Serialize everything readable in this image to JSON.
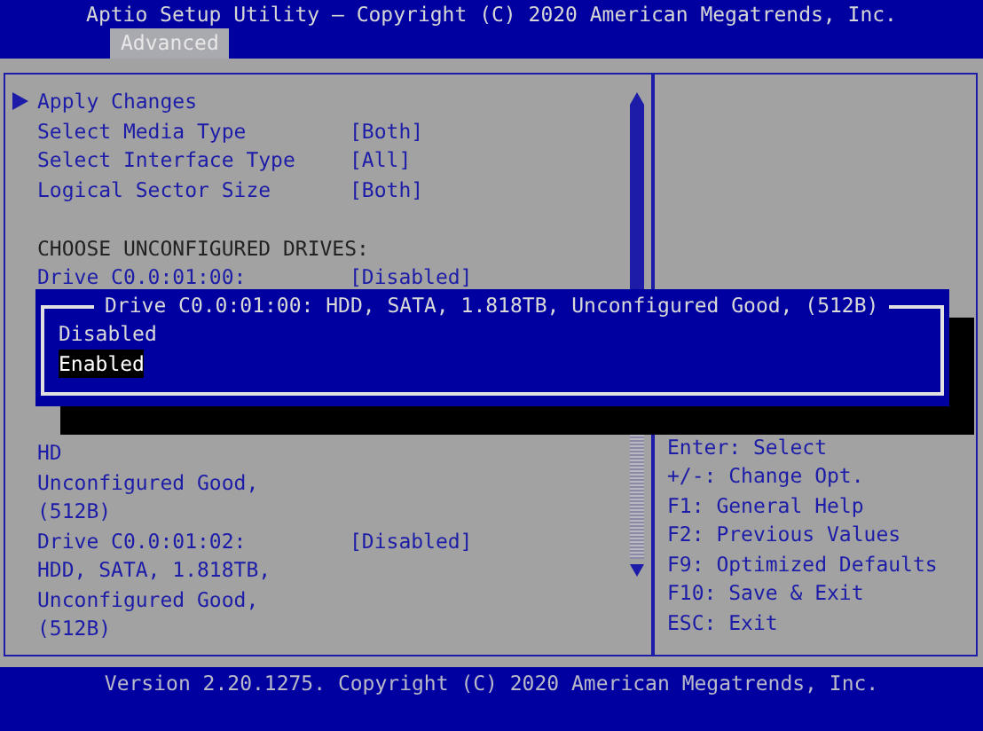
{
  "header": {
    "title": "Aptio Setup Utility – Copyright (C) 2020 American Megatrends, Inc."
  },
  "tabs": [
    {
      "label": "Advanced",
      "selected": true
    }
  ],
  "settings_above": [
    {
      "kind": "submenu",
      "label": "Apply Changes"
    },
    {
      "kind": "option",
      "label": "Select Media Type",
      "value": "[Both]"
    },
    {
      "kind": "option",
      "label": "Select Interface Type",
      "value": "[All]"
    },
    {
      "kind": "option",
      "label": "Logical Sector Size",
      "value": "[Both]"
    },
    {
      "kind": "heading",
      "label": "CHOOSE UNCONFIGURED DRIVES:"
    },
    {
      "kind": "option",
      "label": "Drive C0.0:01:00:",
      "value": "[Disabled]"
    }
  ],
  "settings_below": [
    {
      "kind": "text",
      "label": "HD"
    },
    {
      "kind": "text",
      "label": "Unconfigured Good,"
    },
    {
      "kind": "text",
      "label": "(512B)"
    },
    {
      "kind": "option",
      "label": "Drive C0.0:01:02:",
      "value": "[Disabled]"
    },
    {
      "kind": "text",
      "label": "HDD, SATA, 1.818TB,"
    },
    {
      "kind": "text",
      "label": "Unconfigured Good,"
    },
    {
      "kind": "text",
      "label": "(512B)"
    }
  ],
  "popup": {
    "title": "Drive C0.0:01:00: HDD, SATA, 1.818TB, Unconfigured Good, (512B)",
    "options": [
      {
        "label": "Disabled",
        "selected": false
      },
      {
        "label": "Enabled",
        "selected": true
      }
    ]
  },
  "help": [
    "Enter: Select",
    "+/-: Change Opt.",
    "F1: General Help",
    "F2: Previous Values",
    "F9: Optimized Defaults",
    "F10: Save & Exit",
    "ESC: Exit"
  ],
  "footer": {
    "text": "Version 2.20.1275. Copyright (C) 2020 American Megatrends, Inc."
  }
}
